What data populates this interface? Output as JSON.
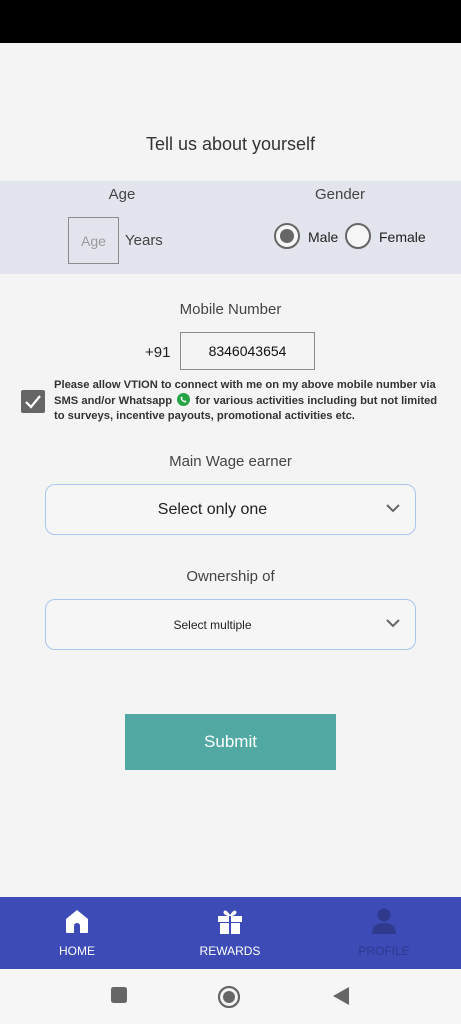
{
  "page": {
    "heading": "Tell us about yourself"
  },
  "age": {
    "label": "Age",
    "placeholder": "Age",
    "value": "",
    "unit": "Years"
  },
  "gender": {
    "label": "Gender",
    "options": [
      {
        "label": "Male",
        "selected": true
      },
      {
        "label": "Female",
        "selected": false
      }
    ]
  },
  "mobile": {
    "label": "Mobile Number",
    "country_code": "+91",
    "value": "8346043654"
  },
  "consent": {
    "checked": true,
    "text_before": "Please allow VTION to connect with me on my above mobile number via SMS and/or Whatsapp",
    "text_after": "for various activities including but not limited to surveys, incentive payouts, promotional activities etc."
  },
  "wage_earner": {
    "label": "Main Wage earner",
    "placeholder": "Select only one"
  },
  "ownership": {
    "label": "Ownership of",
    "placeholder": "Select multiple"
  },
  "submit": {
    "label": "Submit"
  },
  "bottom_nav": {
    "items": [
      {
        "label": "HOME",
        "icon": "home-icon"
      },
      {
        "label": "REWARDS",
        "icon": "gift-icon"
      },
      {
        "label": "PROFILE",
        "icon": "person-icon",
        "active": true
      }
    ]
  },
  "system_nav": {
    "buttons": [
      "square-recents-icon",
      "circle-home-icon",
      "triangle-back-icon"
    ]
  },
  "colors": {
    "accent": "#52a9a3",
    "nav_bg": "#3c4bb6",
    "nav_active_label": "#2f3a8e",
    "select_border": "#a9c6ec",
    "band_bg": "#e3e5ee"
  }
}
